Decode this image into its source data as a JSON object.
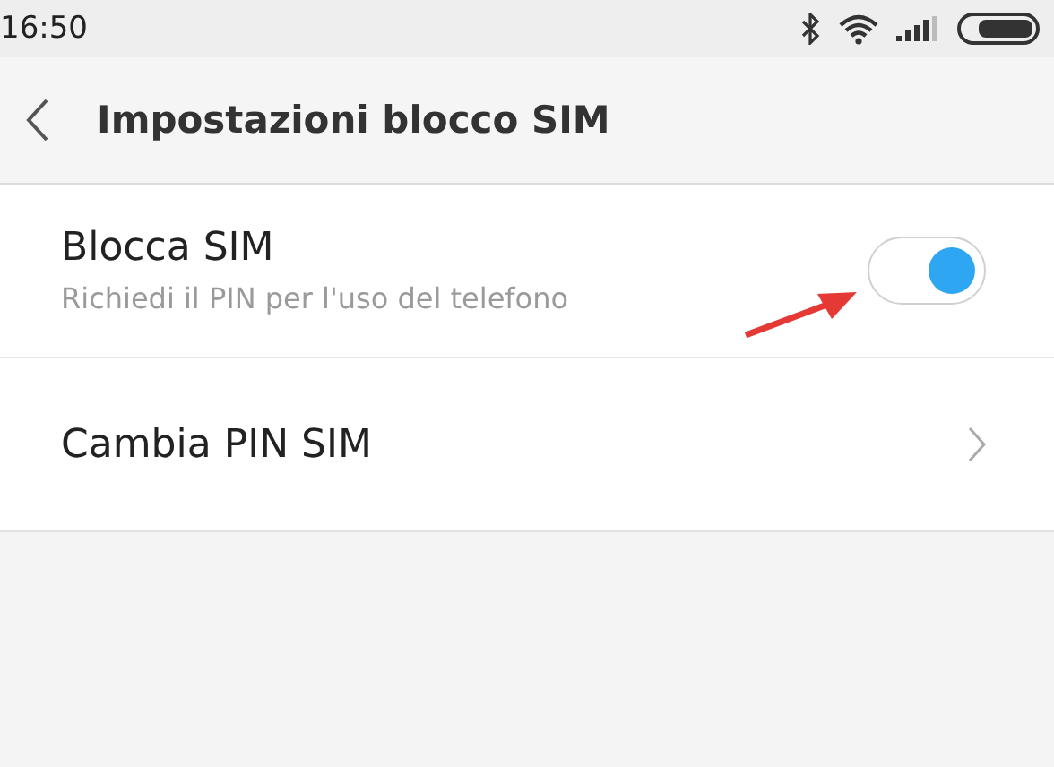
{
  "status_bar": {
    "time": "16:50"
  },
  "header": {
    "title": "Impostazioni blocco SIM"
  },
  "settings": [
    {
      "kind": "toggle",
      "title": "Blocca SIM",
      "subtitle": "Richiedi il PIN per l'uso del telefono",
      "on": true
    },
    {
      "kind": "link",
      "title": "Cambia PIN SIM"
    }
  ]
}
